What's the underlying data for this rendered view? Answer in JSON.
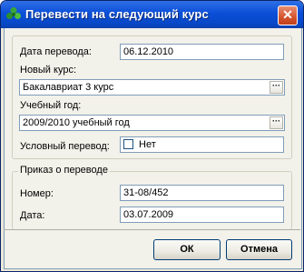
{
  "window": {
    "title": "Перевести на следующий курс",
    "close_glyph": "✕"
  },
  "form": {
    "date_label": "Дата перевода:",
    "date_value": "06.12.2010",
    "course_label": "Новый курс:",
    "course_value": "Бакалавриат 3 курс",
    "year_label": "Учебный год:",
    "year_value": "2009/2010 учебный год",
    "conditional_label": "Условный перевод:",
    "conditional_value": "Нет",
    "conditional_checked": false,
    "ellipsis": "···"
  },
  "order": {
    "caption": "Приказ о переводе",
    "number_label": "Номер:",
    "number_value": "31-08/452",
    "date_label": "Дата:",
    "date_value": "03.07.2009"
  },
  "buttons": {
    "ok": "ОК",
    "cancel": "Отмена"
  }
}
